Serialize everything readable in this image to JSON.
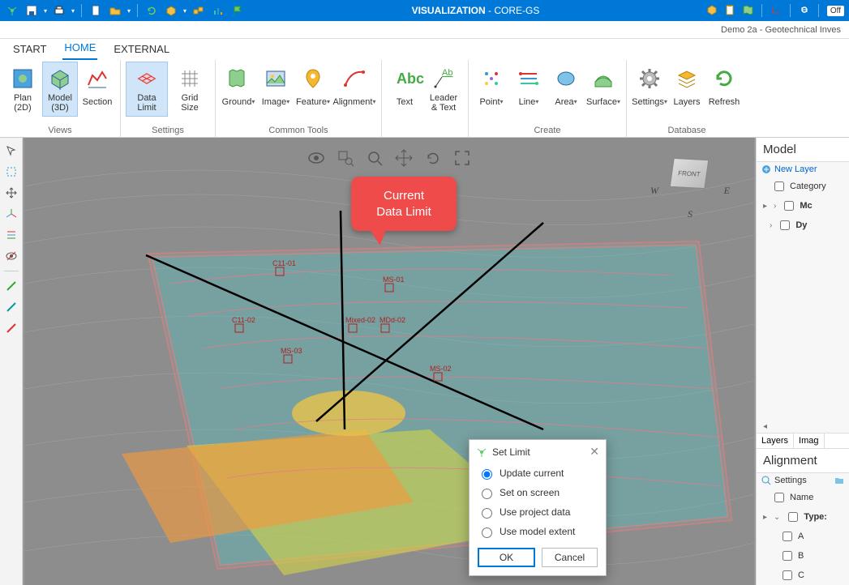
{
  "titlebar": {
    "app_title_strong": "VISUALIZATION",
    "app_title_rest": " - CORE-GS",
    "offline_badge": "Off"
  },
  "fileinfo": {
    "filename": "Demo 2a - Geotechnical Inves"
  },
  "tabs": {
    "start": "START",
    "home": "HOME",
    "external": "EXTERNAL"
  },
  "ribbon": {
    "groups": {
      "views": {
        "label": "Views",
        "plan2d": "Plan (2D)",
        "model3d": "Model (3D)",
        "section": "Section"
      },
      "settings": {
        "label": "Settings",
        "data_limit": "Data Limit",
        "grid_size": "Grid Size"
      },
      "common": {
        "label": "Common Tools",
        "ground": "Ground",
        "image": "Image",
        "feature": "Feature",
        "alignment": "Alignment"
      },
      "text": {
        "text": "Text",
        "leader_text": "Leader & Text"
      },
      "create": {
        "label": "Create",
        "point": "Point",
        "line": "Line",
        "area": "Area",
        "surface": "Surface"
      },
      "database": {
        "label": "Database",
        "settings": "Settings",
        "layers": "Layers",
        "refresh": "Refresh"
      }
    }
  },
  "callout": {
    "line1": "Current",
    "line2": "Data Limit"
  },
  "navcube": {
    "front": "FRONT",
    "w": "W",
    "e": "E",
    "s": "S"
  },
  "dialog": {
    "title": "Set Limit",
    "opt_update": "Update current",
    "opt_screen": "Set on screen",
    "opt_project": "Use project data",
    "opt_model": "Use model extent",
    "ok": "OK",
    "cancel": "Cancel"
  },
  "panel_model": {
    "title": "Model",
    "new_layer": "New Layer",
    "category": "Category",
    "mc": "Mc",
    "dy": "Dy",
    "tab_layers": "Layers",
    "tab_images": "Imag"
  },
  "panel_align": {
    "title": "Alignment",
    "settings": "Settings",
    "name": "Name",
    "type": "Type:",
    "a": "A",
    "b": "B",
    "c": "C"
  }
}
